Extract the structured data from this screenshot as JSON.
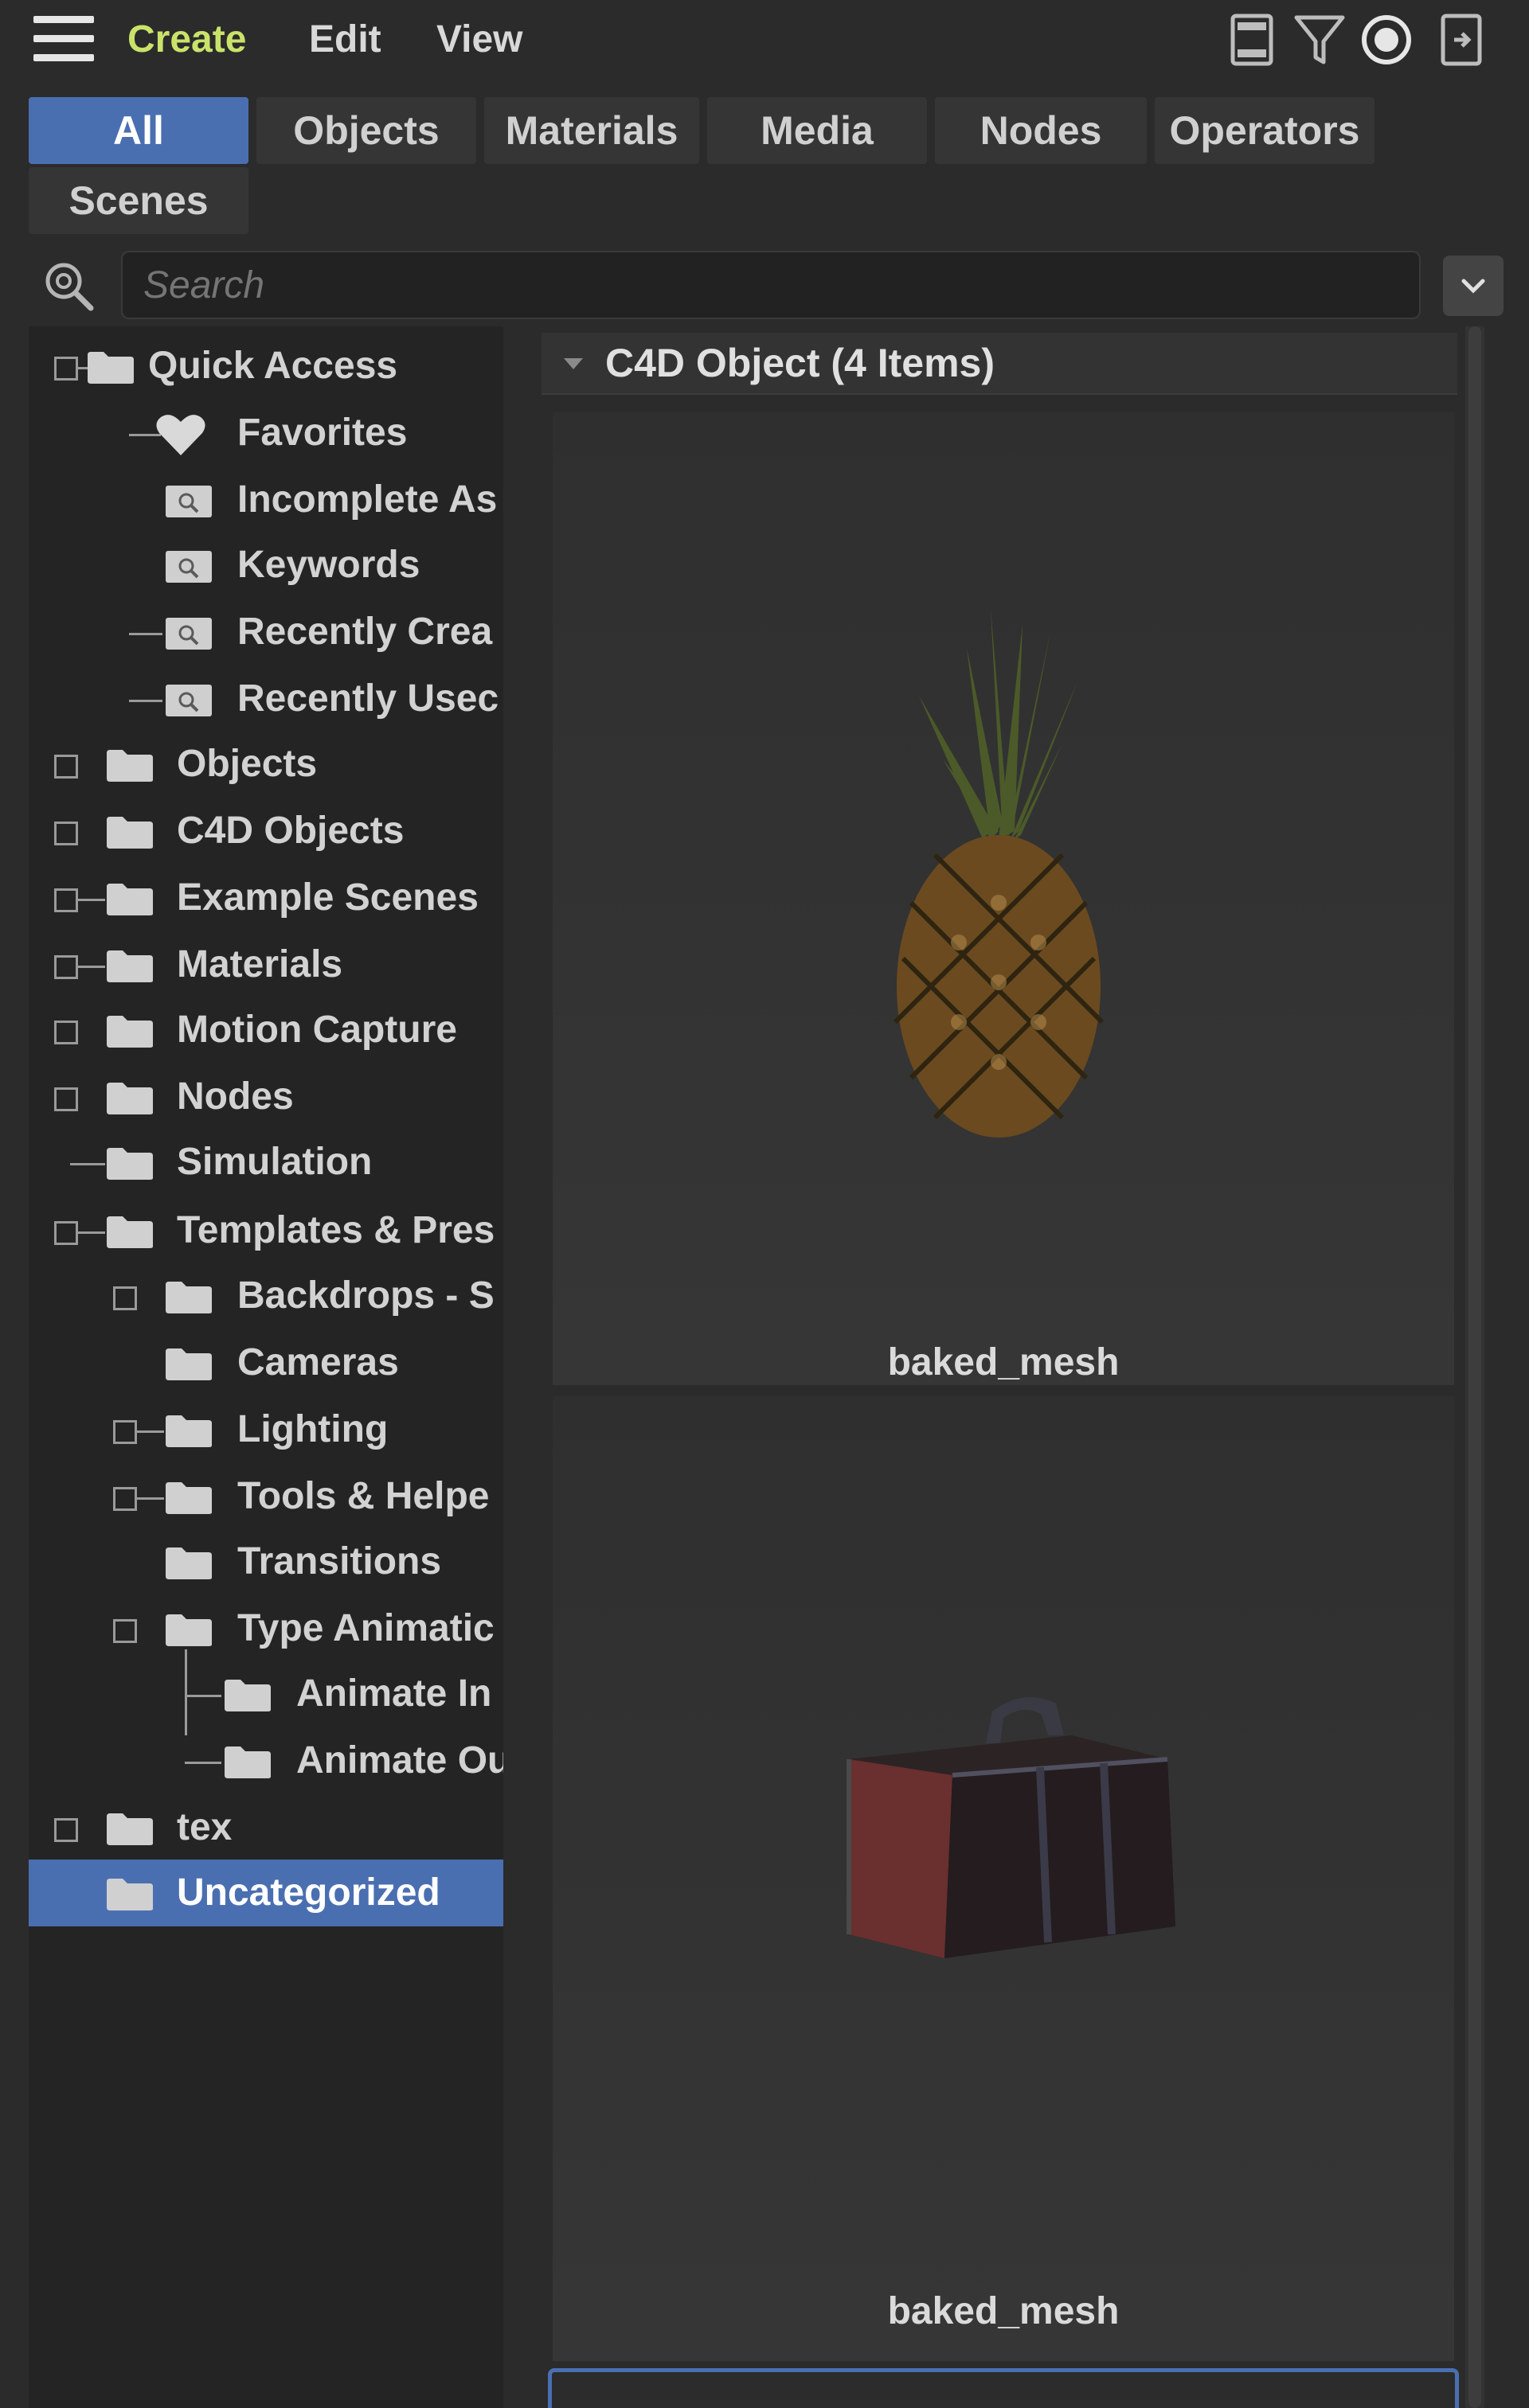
{
  "menubar": {
    "items": [
      {
        "label": "Create"
      },
      {
        "label": "Edit"
      },
      {
        "label": "View"
      }
    ],
    "accent_color": "#c9e36a",
    "icons": [
      "hamburger-menu-icon",
      "panel-layout-icon",
      "filter-icon",
      "target-icon",
      "dock-icon"
    ]
  },
  "tabs": [
    {
      "label": "All",
      "selected": true
    },
    {
      "label": "Objects"
    },
    {
      "label": "Materials"
    },
    {
      "label": "Media"
    },
    {
      "label": "Nodes"
    },
    {
      "label": "Operators"
    },
    {
      "label": "Scenes"
    }
  ],
  "selection_color": "#4a6fb1",
  "search": {
    "placeholder": "Search",
    "value": ""
  },
  "tree": [
    {
      "label": "Quick Access"
    },
    {
      "label": "Favorites"
    },
    {
      "label": "Incomplete As"
    },
    {
      "label": "Keywords"
    },
    {
      "label": "Recently Crea"
    },
    {
      "label": "Recently Usec"
    },
    {
      "label": "Objects"
    },
    {
      "label": "C4D Objects"
    },
    {
      "label": "Example Scenes"
    },
    {
      "label": "Materials"
    },
    {
      "label": "Motion Capture"
    },
    {
      "label": "Nodes"
    },
    {
      "label": "Simulation"
    },
    {
      "label": "Templates & Pres"
    },
    {
      "label": "Backdrops - S"
    },
    {
      "label": "Cameras"
    },
    {
      "label": "Lighting"
    },
    {
      "label": "Tools & Helpe"
    },
    {
      "label": "Transitions"
    },
    {
      "label": "Type Animatic"
    },
    {
      "label": "Animate In"
    },
    {
      "label": "Animate Ou"
    },
    {
      "label": "tex"
    },
    {
      "label": "Uncategorized",
      "selected": true
    }
  ],
  "content": {
    "group_title": "C4D Object (4 Items)",
    "assets": [
      {
        "name": "baked_mesh",
        "thumbnail": "pineapple"
      },
      {
        "name": "baked_mesh",
        "thumbnail": "leather-suitcase"
      }
    ]
  }
}
